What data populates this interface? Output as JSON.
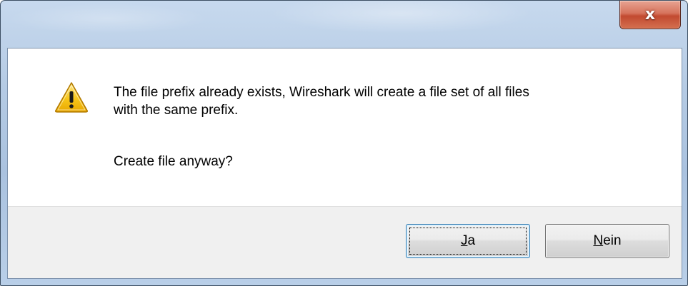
{
  "window": {
    "close_glyph": "x"
  },
  "icon": "warning-icon",
  "message": {
    "line1": "The file prefix already exists, Wireshark will create a file set of all files",
    "line2": "with the same prefix.",
    "question": "Create file anyway?"
  },
  "buttons": {
    "yes": {
      "accel": "J",
      "rest": "a"
    },
    "no": {
      "accel": "N",
      "rest": "ein"
    }
  },
  "colors": {
    "warning_yellow": "#f5c400",
    "close_red": "#c94a30",
    "footer_bg": "#f0f0f0"
  }
}
